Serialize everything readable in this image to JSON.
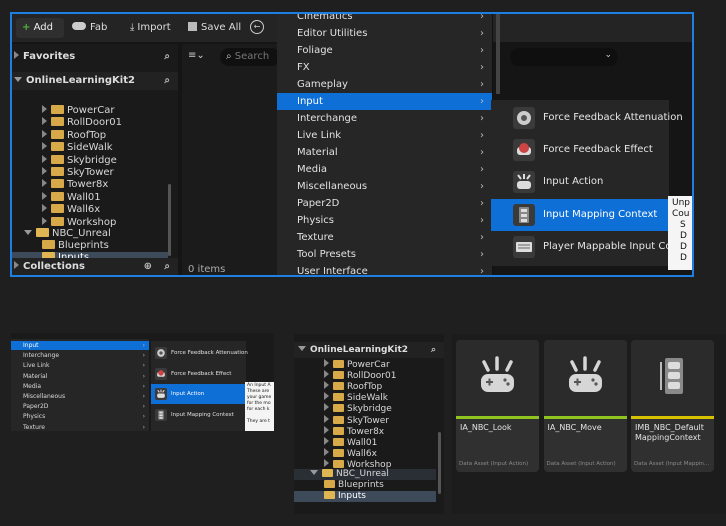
{
  "colors": {
    "accent": "#0e6fd6",
    "folder": "#d8a948",
    "green": "#3c8a2e",
    "selection_border": "#1e7fe0"
  },
  "toolbar": {
    "add": "Add",
    "fab": "Fab",
    "import": "Import",
    "save_all": "Save All"
  },
  "sidebar": {
    "favorites": "Favorites",
    "project": "OnlineLearningKit2",
    "collections": "Collections",
    "folders": [
      "PowerCar",
      "RollDoor01",
      "RoofTop",
      "SideWalk",
      "Skybridge",
      "SkyTower",
      "Tower8x",
      "Wall01",
      "Wall6x",
      "Workshop"
    ],
    "nbc": "NBC_Unreal",
    "blueprints": "Blueprints",
    "inputs": "Inputs"
  },
  "content": {
    "search_placeholder": "Search",
    "item_count": "0 items"
  },
  "menu": {
    "items": [
      "Cinematics",
      "Editor Utilities",
      "Foliage",
      "FX",
      "Gameplay",
      "Input",
      "Interchange",
      "Live Link",
      "Material",
      "Media",
      "Miscellaneous",
      "Paper2D",
      "Physics",
      "Texture",
      "Tool Presets",
      "User Interface"
    ],
    "selected": "Input"
  },
  "submenu": {
    "items": [
      {
        "label": "Force Feedback Attenuation",
        "icon": "force-feedback-attenuation-icon"
      },
      {
        "label": "Force Feedback Effect",
        "icon": "force-feedback-effect-icon"
      },
      {
        "label": "Input Action",
        "icon": "input-action-icon"
      },
      {
        "label": "Input Mapping Context",
        "icon": "input-mapping-context-icon"
      },
      {
        "label": "Player Mappable Input Confi",
        "icon": "player-mappable-input-icon"
      }
    ],
    "selected": "Input Mapping Context"
  },
  "tooltip": {
    "lines": [
      "Unp",
      "Cou",
      "S",
      "D",
      "D",
      "D"
    ]
  },
  "mini_menu": {
    "items": [
      "Input",
      "Interchange",
      "Live Link",
      "Material",
      "Media",
      "Miscellaneous",
      "Paper2D",
      "Physics",
      "Texture"
    ],
    "sub": [
      "Force Feedback Attenuation",
      "Force Feedback Effect",
      "Input Action",
      "Input Mapping Context"
    ],
    "tooltip": [
      "An Input A",
      "These are",
      "your game",
      "for the mo",
      "for each k",
      "They are t"
    ]
  },
  "lower_tree": {
    "project": "OnlineLearningKit2",
    "folders": [
      "PowerCar",
      "RollDoor01",
      "RoofTop",
      "SideWalk",
      "Skybridge",
      "SkyTower",
      "Tower8x",
      "Wall01",
      "Wall6x",
      "Workshop"
    ],
    "nbc": "NBC_Unreal",
    "blueprints": "Blueprints",
    "inputs": "Inputs"
  },
  "assets": [
    {
      "name": "IA_NBC_Look",
      "kind": "Data Asset (Input Action)",
      "color": "#8fc31f"
    },
    {
      "name": "IA_NBC_Move",
      "kind": "Data Asset (Input Action)",
      "color": "#8fc31f"
    },
    {
      "name": "IMB_NBC_Default MappingContext",
      "kind": "Data Asset (Input Mappin...",
      "color": "#d8c200"
    }
  ]
}
